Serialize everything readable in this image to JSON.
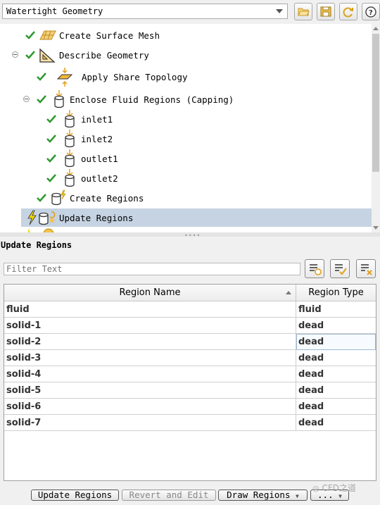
{
  "workflow": {
    "selected": "Watertight Geometry"
  },
  "toolbar": {
    "icons": [
      "open-folder-icon",
      "save-icon",
      "refresh-icon",
      "help-icon"
    ]
  },
  "tree": {
    "items": [
      {
        "label": "Create Surface Mesh"
      },
      {
        "label": "Describe Geometry"
      },
      {
        "label": "Apply Share Topology"
      },
      {
        "label": "Enclose Fluid Regions (Capping)"
      },
      {
        "label": "inlet1"
      },
      {
        "label": "inlet2"
      },
      {
        "label": "outlet1"
      },
      {
        "label": "outlet2"
      },
      {
        "label": "Create Regions"
      },
      {
        "label": "Update Regions"
      }
    ]
  },
  "task": {
    "title": "Update Regions",
    "filter_placeholder": "Filter Text"
  },
  "table": {
    "headers": {
      "name": "Region Name",
      "type": "Region Type"
    },
    "rows": [
      {
        "name": "fluid",
        "type": "fluid"
      },
      {
        "name": "solid-1",
        "type": "dead"
      },
      {
        "name": "solid-2",
        "type": "dead"
      },
      {
        "name": "solid-3",
        "type": "dead"
      },
      {
        "name": "solid-4",
        "type": "dead"
      },
      {
        "name": "solid-5",
        "type": "dead"
      },
      {
        "name": "solid-6",
        "type": "dead"
      },
      {
        "name": "solid-7",
        "type": "dead"
      }
    ]
  },
  "buttons": {
    "update": "Update Regions",
    "revert": "Revert and Edit",
    "draw": "Draw Regions",
    "more": "..."
  },
  "watermark": "CFD之道",
  "colors": {
    "check": "#2e9a2e",
    "selected_row": "#c5d3e2",
    "warning": "#f2d500"
  }
}
